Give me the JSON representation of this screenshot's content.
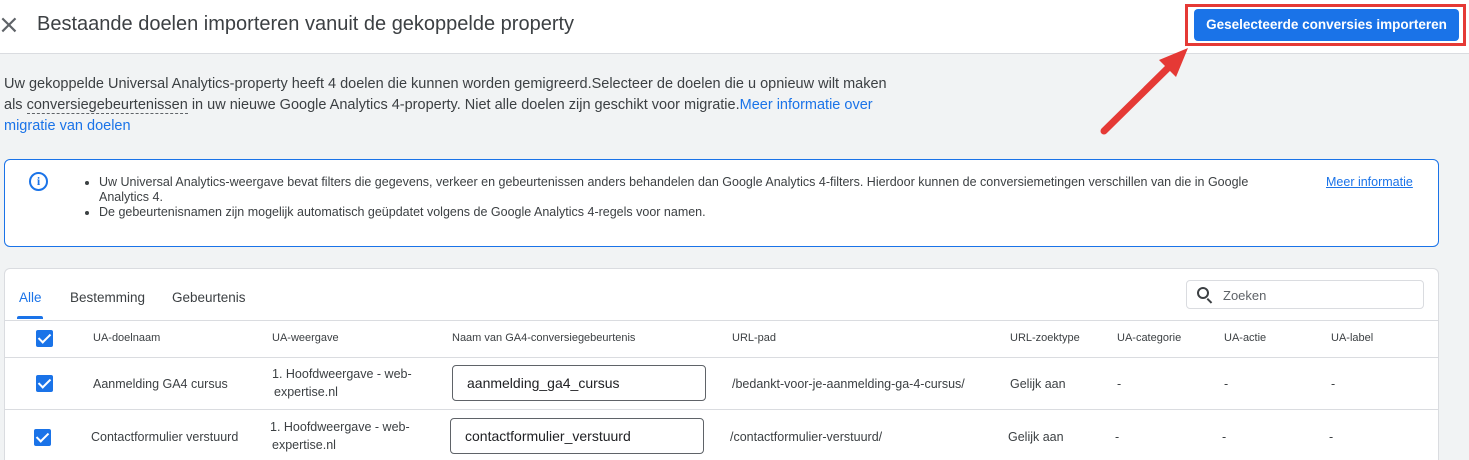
{
  "header": {
    "close_glyph": "×",
    "title": "Bestaande doelen importeren vanuit de gekoppelde property",
    "import_button": "Geselecteerde conversies importeren"
  },
  "intro": {
    "text_before": "Uw gekoppelde Universal Analytics-property heeft 4 doelen die kunnen worden gemigreerd.Selecteer de doelen die u opnieuw wilt maken als ",
    "term": "conversiegebeurtenissen",
    "text_after": " in uw nieuwe Google Analytics 4-property. Niet alle doelen zijn geschikt voor migratie.",
    "link": "Meer informatie over migratie van doelen"
  },
  "info": {
    "icon_glyph": "i",
    "bullets": [
      "Uw Universal Analytics-weergave bevat filters die gegevens, verkeer en gebeurtenissen anders behandelen dan Google Analytics 4-filters. Hierdoor kunnen de conversiemetingen verschillen van die in Google Analytics 4.",
      "De gebeurtenisnamen zijn mogelijk automatisch geüpdatet volgens de Google Analytics 4-regels voor namen."
    ],
    "more_link": "Meer informatie"
  },
  "tabs": [
    "Alle",
    "Bestemming",
    "Gebeurtenis"
  ],
  "search": {
    "placeholder": "Zoeken"
  },
  "table": {
    "headers": [
      "UA-doelnaam",
      "UA-weergave",
      "Naam van GA4-conversiegebeurtenis",
      "URL-pad",
      "URL-zoektype",
      "UA-categorie",
      "UA-actie",
      "UA-label"
    ],
    "rows": [
      {
        "goal_name": "Aanmelding GA4 cursus",
        "view_line1": "1. Hoofdweergave - web-",
        "view_line2": "expertise.nl",
        "ga4_event": "aanmelding_ga4_cursus",
        "url_path": "/bedankt-voor-je-aanmelding-ga-4-cursus/",
        "match_type": "Gelijk aan",
        "category": "-",
        "action": "-",
        "label": "-"
      },
      {
        "goal_name": "Contactformulier verstuurd",
        "view_line1": "1. Hoofdweergave - web-",
        "view_line2": "expertise.nl",
        "ga4_event": "contactformulier_verstuurd",
        "url_path": "/contactformulier-verstuurd/",
        "match_type": "Gelijk aan",
        "category": "-",
        "action": "-",
        "label": "-"
      }
    ]
  },
  "colors": {
    "accent": "#1a73e8",
    "annotation": "#e53935"
  }
}
